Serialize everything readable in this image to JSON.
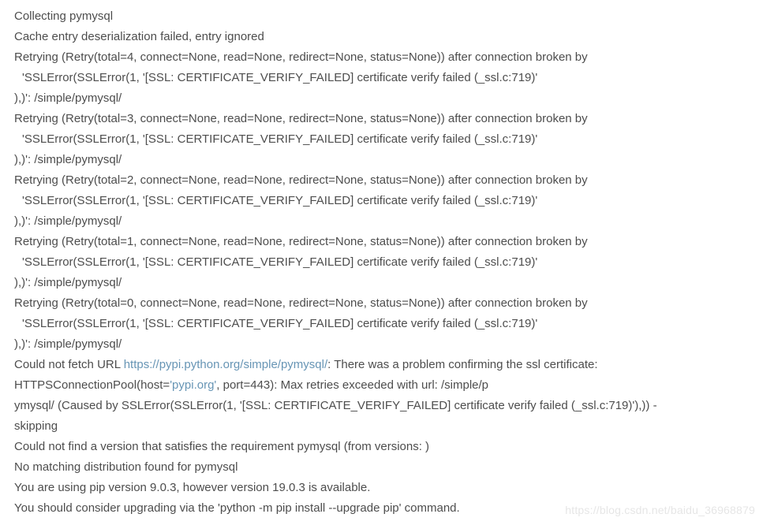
{
  "log": {
    "collecting": "Collecting pymysql",
    "cache_fail": "Cache entry deserialization failed, entry ignored",
    "retries": [
      {
        "head": "Retrying (Retry(total=4, connect=None, read=None, redirect=None, status=None)) after connection broken by",
        "err": "'SSLError(SSLError(1, '[SSL: CERTIFICATE_VERIFY_FAILED] certificate verify failed (_ssl.c:719)'",
        "tail": "),)': /simple/pymysql/"
      },
      {
        "head": "Retrying (Retry(total=3, connect=None, read=None, redirect=None, status=None)) after connection broken by",
        "err": "'SSLError(SSLError(1, '[SSL: CERTIFICATE_VERIFY_FAILED] certificate verify failed (_ssl.c:719)'",
        "tail": "),)': /simple/pymysql/"
      },
      {
        "head": "Retrying (Retry(total=2, connect=None, read=None, redirect=None, status=None)) after connection broken by",
        "err": "'SSLError(SSLError(1, '[SSL: CERTIFICATE_VERIFY_FAILED] certificate verify failed (_ssl.c:719)'",
        "tail": "),)': /simple/pymysql/"
      },
      {
        "head": "Retrying (Retry(total=1, connect=None, read=None, redirect=None, status=None)) after connection broken by",
        "err": "'SSLError(SSLError(1, '[SSL: CERTIFICATE_VERIFY_FAILED] certificate verify failed (_ssl.c:719)'",
        "tail": "),)': /simple/pymysql/"
      },
      {
        "head": "Retrying (Retry(total=0, connect=None, read=None, redirect=None, status=None)) after connection broken by",
        "err": "'SSLError(SSLError(1, '[SSL: CERTIFICATE_VERIFY_FAILED] certificate verify failed (_ssl.c:719)'",
        "tail": "),)': /simple/pymysql/"
      }
    ],
    "fetch_fail_pre": "Could not fetch URL ",
    "fetch_fail_url": "https://pypi.python.org/simple/pymysql/",
    "fetch_fail_post": ": There was a problem confirming the ssl certificate:",
    "pool_pre": "HTTPSConnectionPool(host=",
    "pool_host": "'pypi.org'",
    "pool_post": ", port=443): Max retries exceeded with url: /simple/p",
    "pool_line2": "ymysql/ (Caused by SSLError(SSLError(1, '[SSL: CERTIFICATE_VERIFY_FAILED] certificate verify failed (_ssl.c:719)'),)) -",
    "pool_line3": "skipping",
    "no_version": "Could not find a version that satisfies the requirement pymysql (from versions: )",
    "no_dist": "No matching distribution found for pymysql",
    "pip_old": "You are using pip version 9.0.3, however version 19.0.3 is available.",
    "upgrade_pre": "You should consider upgrading via the ",
    "upgrade_cmd": "'python -m pip install --upgrade pip'",
    "upgrade_post": " command."
  },
  "watermark": "https://blog.csdn.net/baidu_36968879"
}
